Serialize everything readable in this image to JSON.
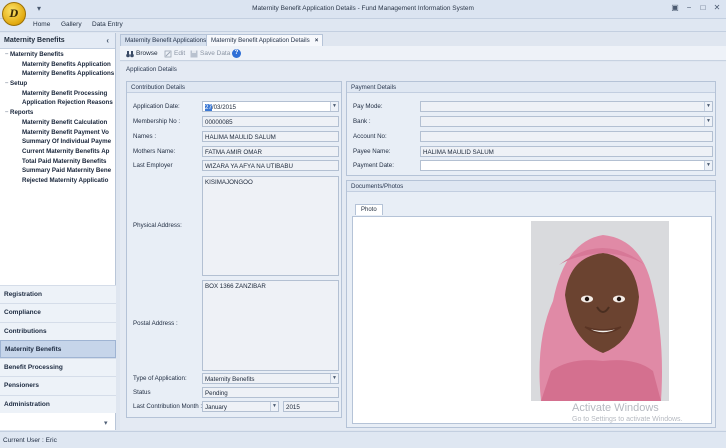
{
  "window": {
    "title": "Maternity Benefit Application Details - Fund Management Information System",
    "logo_text": "D"
  },
  "menu": [
    "Home",
    "Gallery",
    "Data Entry"
  ],
  "left_panel": {
    "header": "Maternity Benefits",
    "tree": [
      {
        "label": "Maternity Benefits",
        "level": 0,
        "expander": "−"
      },
      {
        "label": "Maternity Benefits Application",
        "level": 1
      },
      {
        "label": "Maternity Benefits Applications",
        "level": 1
      },
      {
        "label": "Setup",
        "level": 0,
        "expander": "−"
      },
      {
        "label": "Maternity Benefit Processing",
        "level": 1
      },
      {
        "label": "Application Rejection Reasons",
        "level": 1
      },
      {
        "label": "Reports",
        "level": 0,
        "expander": "−"
      },
      {
        "label": "Maternity Benefit Calculation",
        "level": 1
      },
      {
        "label": "Maternity Benefit Payment Vo",
        "level": 1
      },
      {
        "label": "Summary Of Individual Payme",
        "level": 1
      },
      {
        "label": "Current Maternity Benefits Ap",
        "level": 1
      },
      {
        "label": "Total Paid Maternity Benefits",
        "level": 1
      },
      {
        "label": "Summary Paid Maternity Bene",
        "level": 1
      },
      {
        "label": "Rejected Maternity Applicatio",
        "level": 1
      }
    ],
    "nav_groups": [
      {
        "label": "Registration",
        "active": false
      },
      {
        "label": "Compliance",
        "active": false
      },
      {
        "label": "Contributions",
        "active": false
      },
      {
        "label": "Maternity Benefits",
        "active": true
      },
      {
        "label": "Benefit Processing",
        "active": false
      },
      {
        "label": "Pensioners",
        "active": false
      },
      {
        "label": "Administration",
        "active": false
      }
    ]
  },
  "tabs": [
    {
      "label": "Maternity Benefit Applications",
      "active": false
    },
    {
      "label": "Maternity Benefit Application Details",
      "active": true,
      "close": "×"
    }
  ],
  "toolbar": {
    "browse": "Browse",
    "edit": "Edit",
    "save": "Save Data",
    "help": "?"
  },
  "content": {
    "section_title": "Application Details",
    "contribution": {
      "title": "Contribution Details",
      "application_date_label": "Application Date:",
      "application_date_sel": "27",
      "application_date_rest": "/03/2015",
      "membership_label": "Membership No :",
      "membership_value": "00000085",
      "names_label": "Names :",
      "names_value": "HALIMA MAULID SALUM",
      "mothers_label": "Mothers Name:",
      "mothers_value": "FATMA AMIR OMAR",
      "employer_label": "Last Employer",
      "employer_value": "WIZARA YA AFYA NA UTIBABU",
      "physical_label": "Physical Address:",
      "physical_value": "KISIMAJONGOO",
      "postal_label": "Postal Address :",
      "postal_value": "BOX 1366 ZANZIBAR",
      "type_label": "Type of Application:",
      "type_value": "Maternity Benefits",
      "status_label": "Status",
      "status_value": "Pending",
      "last_month_label": "Last Contribution Month :",
      "last_month_value": "January",
      "last_year_value": "2015"
    },
    "payment": {
      "title": "Payment Details",
      "pay_mode_label": "Pay Mode:",
      "bank_label": "Bank :",
      "account_label": "Account No:",
      "payee_label": "Payee Name:",
      "payee_value": "HALIMA MAULID SALUM",
      "payment_date_label": "Payment Date:"
    },
    "documents": {
      "title": "Documents/Photos",
      "tab": "Photo"
    }
  },
  "watermark": {
    "line1": "Activate Windows",
    "line2": "Go to Settings to activate Windows."
  },
  "status_bar": {
    "user_label": "Current User :",
    "user_value": "Eric"
  }
}
